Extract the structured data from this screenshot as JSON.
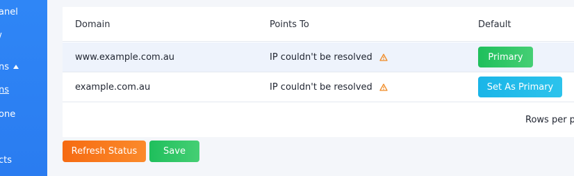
{
  "sidebar": {
    "items": [
      {
        "label": "anel"
      },
      {
        "label": "/"
      },
      {
        "label": "ns"
      },
      {
        "label": "ns"
      },
      {
        "label": "one"
      },
      {
        "label": "cts"
      }
    ]
  },
  "table": {
    "columns": [
      "Domain",
      "Points To",
      "Default"
    ],
    "rows": [
      {
        "domain": "www.example.com.au",
        "points_to": "IP couldn't be resolved",
        "action": "Primary"
      },
      {
        "domain": "example.com.au",
        "points_to": "IP couldn't be resolved",
        "action": "Set As Primary"
      }
    ],
    "rows_per_page_label": "Rows per p"
  },
  "actions": {
    "refresh_label": "Refresh Status",
    "save_label": "Save"
  },
  "colors": {
    "sidebar": "#2f86f6",
    "primary_green": "#1fbf5c",
    "set_primary_cyan": "#1ab5e8",
    "refresh_orange": "#f66b12",
    "warning_orange": "#f08a24"
  }
}
